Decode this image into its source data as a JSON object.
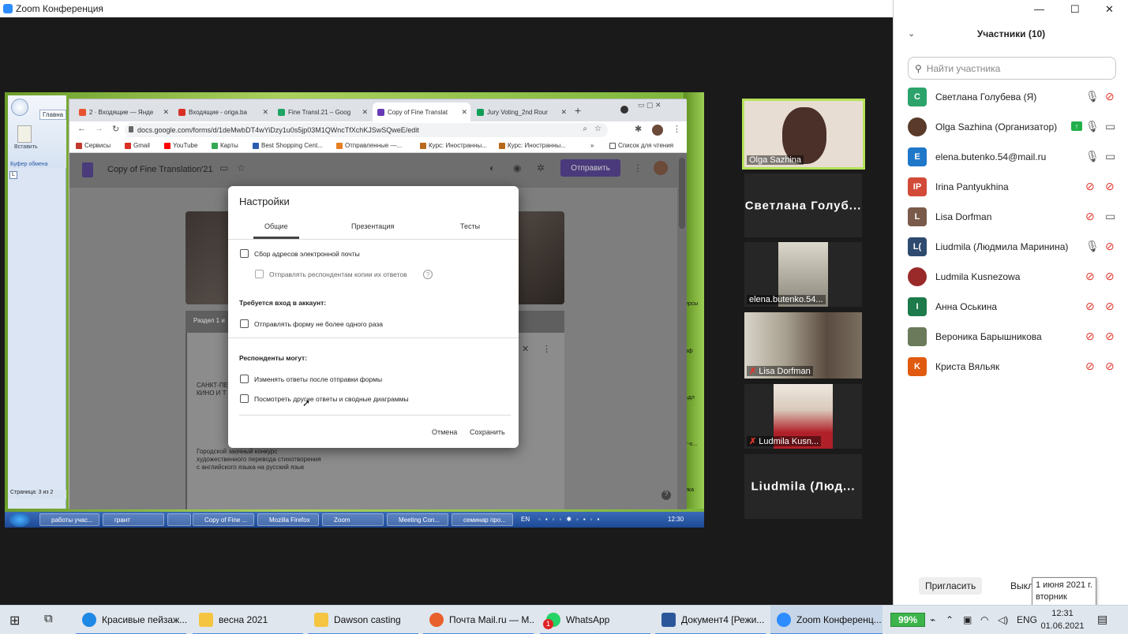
{
  "zoom": {
    "title": "Zoom Конференция",
    "window_controls": {
      "minimize": "—",
      "maximize": "☐",
      "close": "✕"
    }
  },
  "remote": {
    "word": {
      "tab": "Главна",
      "paste": "Вставить",
      "clipboard": "Буфер обмена",
      "status": "Страница: 3 из 2",
      "right_snippets": [
        "ерсы",
        "аф",
        "ьдл",
        "т-о...",
        "ика"
      ]
    },
    "chrome": {
      "tabs": [
        {
          "label": "2 · Входящие — Янде",
          "color": "#e8532f",
          "active": false
        },
        {
          "label": "Входящие - origa.ba",
          "color": "#d93025",
          "active": false
        },
        {
          "label": "Fine Transl.21 – Goog",
          "color": "#1fa463",
          "active": false
        },
        {
          "label": "Copy of Fine Translat",
          "color": "#673ab7",
          "active": true
        },
        {
          "label": "Jury Voting_2nd Rour",
          "color": "#0f9d58",
          "active": false
        }
      ],
      "url": "docs.google.com/forms/d/1deMwbDT4wYiDzy1u0s5jp03M1QWncTfXchKJSwSQweE/edit",
      "bookmarks": [
        {
          "label": "Сервисы",
          "color": "#c0392b"
        },
        {
          "label": "Gmail",
          "color": "#d93025"
        },
        {
          "label": "YouTube",
          "color": "#ff0000"
        },
        {
          "label": "Карты",
          "color": "#34a853"
        },
        {
          "label": "Best Shopping Cent...",
          "color": "#2a5db0"
        },
        {
          "label": "Отправленные —...",
          "color": "#e67e22"
        },
        {
          "label": "Курс: Иностранны...",
          "color": "#b8681c"
        },
        {
          "label": "Курс: Иностранны...",
          "color": "#b8681c"
        }
      ],
      "reading_list": "Список для чтения"
    },
    "forms": {
      "title": "Copy of Fine Translation'21",
      "send_label": "Отправить",
      "section_label": "Раздел 1 и",
      "card_text_1": "САНКТ-ПЕ\nКИНО И Т",
      "card_text_2": "Городской заочный конкурс\nхудожественного перевода стихотворения\nс английского языка на русский язык"
    },
    "dialog": {
      "title": "Настройки",
      "tabs": [
        "Общие",
        "Презентация",
        "Тесты"
      ],
      "options": {
        "collect_email": "Сбор адресов электронной почты",
        "send_copy": "Отправлять респондентам копии их ответов",
        "login_heading": "Требуется вход в аккаунт:",
        "one_response": "Отправлять форму не более одного раза",
        "respondents_heading": "Респонденты могут:",
        "edit_after": "Изменять ответы после отправки формы",
        "see_summary": "Посмотреть другие ответы и сводные диаграммы"
      },
      "cancel": "Отмена",
      "save": "Сохранить"
    },
    "taskbar": {
      "items": [
        "работы учас...",
        "грант",
        "",
        "Copy of Fine ...",
        "Mozilla Firefox",
        "Zoom",
        "Meeting Con...",
        "семинар про..."
      ],
      "lang": "EN",
      "time": "12:30"
    }
  },
  "tiles": [
    {
      "name": "Olga Sazhina",
      "type": "video",
      "mic_off": false
    },
    {
      "name": "Светлана  Голуб...",
      "type": "name",
      "mic_off": false
    },
    {
      "name": "elena.butenko.54...",
      "type": "video",
      "mic_off": false
    },
    {
      "name": "Lisa Dorfman",
      "type": "video",
      "mic_off": true
    },
    {
      "name": "Ludmila Kusn...",
      "type": "video",
      "mic_off": true
    },
    {
      "name": "Liudmila  (Люд...",
      "type": "name",
      "mic_off": false
    }
  ],
  "panel": {
    "title": "Участники (10)",
    "search_placeholder": "Найти участника",
    "participants": [
      {
        "name": "Светлана Голубева (Я)",
        "initials": "С",
        "color": "#2ba36b",
        "mic": "on",
        "cam": "off"
      },
      {
        "name": "Olga Sazhina (Организатор)",
        "initials": "",
        "color": "#5a3a2a",
        "mic": "on",
        "cam": "on",
        "sharing": true
      },
      {
        "name": "elena.butenko.54@mail.ru",
        "initials": "E",
        "color": "#1f77c9",
        "mic": "on",
        "cam": "on"
      },
      {
        "name": "Irina Pantyukhina",
        "initials": "IP",
        "color": "#d24a38",
        "mic": "off",
        "cam": "off"
      },
      {
        "name": "Lisa Dorfman",
        "initials": "L",
        "color": "#7a5a4a",
        "mic": "off",
        "cam": "on"
      },
      {
        "name": "Liudmila (Людмила Маринина)",
        "initials": "L(",
        "color": "#2e4a6e",
        "mic": "on",
        "cam": "off"
      },
      {
        "name": "Ludmila Kusnezowa",
        "initials": "",
        "color": "#9a2a2a",
        "mic": "off",
        "cam": "off"
      },
      {
        "name": "Анна Оськина",
        "initials": "I",
        "color": "#1d7a4a",
        "mic": "off",
        "cam": "off"
      },
      {
        "name": "Вероника Барышникова",
        "initials": "",
        "color": "#6a7a5a",
        "mic": "off",
        "cam": "off"
      },
      {
        "name": "Криста Вяльяк",
        "initials": "K",
        "color": "#e05a10",
        "mic": "off",
        "cam": "off"
      }
    ],
    "invite": "Пригласить",
    "mute_all": "Выкл",
    "tooltip": "1 июня 2021 г.\nвторник"
  },
  "taskbar": {
    "items": [
      {
        "label": "Красивые пейзаж...",
        "color": "#1e88e5"
      },
      {
        "label": "весна 2021",
        "color": "#f5c542"
      },
      {
        "label": "Dawson casting",
        "color": "#f5c542"
      },
      {
        "label": "Почта Mail.ru — M...",
        "color": "#e8602c"
      },
      {
        "label": "WhatsApp",
        "color": "#25d366",
        "badge": "1"
      },
      {
        "label": "Документ4 [Режи...",
        "color": "#2b579a"
      },
      {
        "label": "Zoom Конференц...",
        "color": "#2d8cff",
        "active": true
      }
    ],
    "battery": "99%",
    "lang": "ENG",
    "time": "12:31",
    "date": "01.06.2021"
  }
}
